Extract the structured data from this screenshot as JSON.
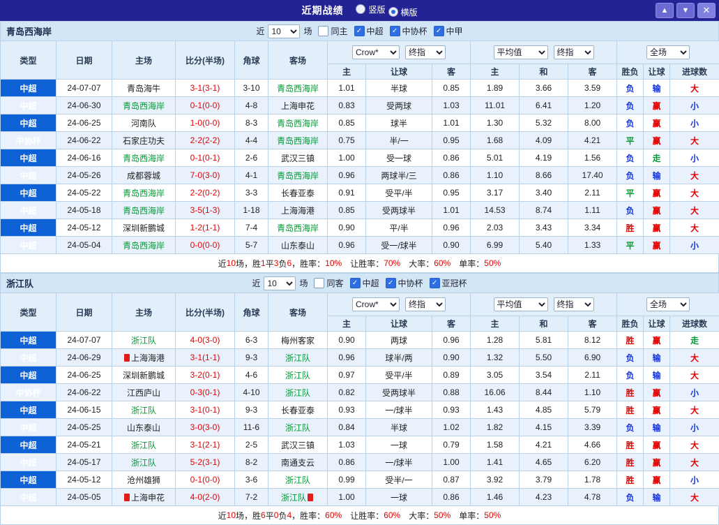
{
  "topbar": {
    "title": "近期战绩",
    "radios": [
      {
        "label": "竖版",
        "selected": false
      },
      {
        "label": "横版",
        "selected": true
      }
    ],
    "up": "▲",
    "down": "▼",
    "close": "✕"
  },
  "colors": {
    "topbar_bg": "#232394",
    "type_cell_blue": "#0f62d6",
    "win_red": "#e60000",
    "loss_blue": "#1535d8",
    "draw_green": "#009933",
    "team_green": "#009933",
    "alt_row": "#e9f2fc",
    "header_bg": "#e2eef9",
    "section_bar_bg": "#d2e6f6"
  },
  "columns": {
    "main": [
      "类型",
      "日期",
      "主场",
      "比分(半场)",
      "角球",
      "客场"
    ],
    "sub": [
      "主",
      "让球",
      "客",
      "主",
      "和",
      "客",
      "胜负",
      "让球",
      "进球数"
    ]
  },
  "sections": [
    {
      "team": "青岛西海岸",
      "controls": {
        "near": "近",
        "count": "10",
        "games": "场",
        "same": {
          "label": "同主",
          "checked": false
        },
        "leagues": [
          {
            "label": "中超",
            "checked": true
          },
          {
            "label": "中协杯",
            "checked": true
          },
          {
            "label": "中甲",
            "checked": true
          }
        ]
      },
      "selects": {
        "book": "Crow*",
        "book2": "终指",
        "avg": "平均值",
        "avg2": "终指",
        "scope": "全场"
      },
      "rows": [
        {
          "type": "中超",
          "date": "24-07-07",
          "home": {
            "t": "青岛海牛",
            "g": false
          },
          "score": "3-1(3-1)",
          "corner": "3-10",
          "away": {
            "t": "青岛西海岸",
            "g": true
          },
          "odds": [
            "1.01",
            "半球",
            "0.85"
          ],
          "avg": [
            "1.89",
            "3.66",
            "3.59"
          ],
          "res": [
            [
              "负",
              "blue"
            ],
            [
              "输",
              "blue"
            ],
            [
              "大",
              "red"
            ]
          ]
        },
        {
          "type": "中超",
          "date": "24-06-30",
          "home": {
            "t": "青岛西海岸",
            "g": true
          },
          "score": "0-1(0-0)",
          "corner": "4-8",
          "away": {
            "t": "上海申花",
            "g": false
          },
          "odds": [
            "0.83",
            "受两球",
            "1.03"
          ],
          "avg": [
            "11.01",
            "6.41",
            "1.20"
          ],
          "res": [
            [
              "负",
              "blue"
            ],
            [
              "赢",
              "red"
            ],
            [
              "小",
              "blue"
            ]
          ]
        },
        {
          "type": "中超",
          "date": "24-06-25",
          "home": {
            "t": "河南队",
            "g": false
          },
          "score": "1-0(0-0)",
          "corner": "8-3",
          "away": {
            "t": "青岛西海岸",
            "g": true
          },
          "odds": [
            "0.85",
            "球半",
            "1.01"
          ],
          "avg": [
            "1.30",
            "5.32",
            "8.00"
          ],
          "res": [
            [
              "负",
              "blue"
            ],
            [
              "赢",
              "red"
            ],
            [
              "小",
              "blue"
            ]
          ]
        },
        {
          "type": "中协杯",
          "date": "24-06-22",
          "home": {
            "t": "石家庄功夫",
            "g": false
          },
          "score": "2-2(2-2)",
          "corner": "4-4",
          "away": {
            "t": "青岛西海岸",
            "g": true
          },
          "odds": [
            "0.75",
            "半/一",
            "0.95"
          ],
          "avg": [
            "1.68",
            "4.09",
            "4.21"
          ],
          "res": [
            [
              "平",
              "green"
            ],
            [
              "赢",
              "red"
            ],
            [
              "大",
              "red"
            ]
          ]
        },
        {
          "type": "中超",
          "date": "24-06-16",
          "home": {
            "t": "青岛西海岸",
            "g": true
          },
          "score": "0-1(0-1)",
          "corner": "2-6",
          "away": {
            "t": "武汉三镇",
            "g": false
          },
          "odds": [
            "1.00",
            "受一球",
            "0.86"
          ],
          "avg": [
            "5.01",
            "4.19",
            "1.56"
          ],
          "res": [
            [
              "负",
              "blue"
            ],
            [
              "走",
              "green"
            ],
            [
              "小",
              "blue"
            ]
          ]
        },
        {
          "type": "中超",
          "date": "24-05-26",
          "home": {
            "t": "成都蓉城",
            "g": false
          },
          "score": "7-0(3-0)",
          "corner": "4-1",
          "away": {
            "t": "青岛西海岸",
            "g": true
          },
          "odds": [
            "0.96",
            "两球半/三",
            "0.86"
          ],
          "avg": [
            "1.10",
            "8.66",
            "17.40"
          ],
          "res": [
            [
              "负",
              "blue"
            ],
            [
              "输",
              "blue"
            ],
            [
              "大",
              "red"
            ]
          ]
        },
        {
          "type": "中超",
          "date": "24-05-22",
          "home": {
            "t": "青岛西海岸",
            "g": true
          },
          "score": "2-2(0-2)",
          "corner": "3-3",
          "away": {
            "t": "长春亚泰",
            "g": false
          },
          "odds": [
            "0.91",
            "受平/半",
            "0.95"
          ],
          "avg": [
            "3.17",
            "3.40",
            "2.11"
          ],
          "res": [
            [
              "平",
              "green"
            ],
            [
              "赢",
              "red"
            ],
            [
              "大",
              "red"
            ]
          ]
        },
        {
          "type": "中超",
          "date": "24-05-18",
          "home": {
            "t": "青岛西海岸",
            "g": true
          },
          "score": "3-5(1-3)",
          "corner": "1-18",
          "away": {
            "t": "上海海港",
            "g": false
          },
          "odds": [
            "0.85",
            "受两球半",
            "1.01"
          ],
          "avg": [
            "14.53",
            "8.74",
            "1.11"
          ],
          "res": [
            [
              "负",
              "blue"
            ],
            [
              "赢",
              "red"
            ],
            [
              "大",
              "red"
            ]
          ]
        },
        {
          "type": "中超",
          "date": "24-05-12",
          "home": {
            "t": "深圳新鹏城",
            "g": false
          },
          "score": "1-2(1-1)",
          "corner": "7-4",
          "away": {
            "t": "青岛西海岸",
            "g": true
          },
          "odds": [
            "0.90",
            "平/半",
            "0.96"
          ],
          "avg": [
            "2.03",
            "3.43",
            "3.34"
          ],
          "res": [
            [
              "胜",
              "red"
            ],
            [
              "赢",
              "red"
            ],
            [
              "大",
              "red"
            ]
          ]
        },
        {
          "type": "中超",
          "date": "24-05-04",
          "home": {
            "t": "青岛西海岸",
            "g": true
          },
          "score": "0-0(0-0)",
          "corner": "5-7",
          "away": {
            "t": "山东泰山",
            "g": false
          },
          "odds": [
            "0.96",
            "受一/球半",
            "0.90"
          ],
          "avg": [
            "6.99",
            "5.40",
            "1.33"
          ],
          "res": [
            [
              "平",
              "green"
            ],
            [
              "赢",
              "red"
            ],
            [
              "小",
              "blue"
            ]
          ]
        }
      ],
      "footer": [
        [
          "近",
          "black"
        ],
        [
          "10",
          "red"
        ],
        [
          "场，胜",
          "black"
        ],
        [
          "1",
          "red"
        ],
        [
          "平",
          "black"
        ],
        [
          "3",
          "red"
        ],
        [
          "负",
          "black"
        ],
        [
          "6",
          "red"
        ],
        [
          "，胜率：",
          "black"
        ],
        [
          "10%",
          "red"
        ],
        [
          "　让胜率：",
          "black"
        ],
        [
          "70%",
          "red"
        ],
        [
          "　大率：",
          "black"
        ],
        [
          "60%",
          "red"
        ],
        [
          "　单率：",
          "black"
        ],
        [
          "50%",
          "red"
        ]
      ]
    },
    {
      "team": "浙江队",
      "controls": {
        "near": "近",
        "count": "10",
        "games": "场",
        "same": {
          "label": "同客",
          "checked": false
        },
        "leagues": [
          {
            "label": "中超",
            "checked": true
          },
          {
            "label": "中协杯",
            "checked": true
          },
          {
            "label": "亚冠杯",
            "checked": true
          }
        ]
      },
      "selects": {
        "book": "Crow*",
        "book2": "终指",
        "avg": "平均值",
        "avg2": "终指",
        "scope": "全场"
      },
      "rows": [
        {
          "type": "中超",
          "date": "24-07-07",
          "home": {
            "t": "浙江队",
            "g": true
          },
          "score": "4-0(3-0)",
          "corner": "6-3",
          "away": {
            "t": "梅州客家",
            "g": false
          },
          "odds": [
            "0.90",
            "两球",
            "0.96"
          ],
          "avg": [
            "1.28",
            "5.81",
            "8.12"
          ],
          "res": [
            [
              "胜",
              "red"
            ],
            [
              "赢",
              "red"
            ],
            [
              "走",
              "green"
            ]
          ]
        },
        {
          "type": "中超",
          "date": "24-06-29",
          "home": {
            "t": "上海海港",
            "g": false,
            "icon": "before"
          },
          "score": "3-1(1-1)",
          "corner": "9-3",
          "away": {
            "t": "浙江队",
            "g": true
          },
          "odds": [
            "0.96",
            "球半/两",
            "0.90"
          ],
          "avg": [
            "1.32",
            "5.50",
            "6.90"
          ],
          "res": [
            [
              "负",
              "blue"
            ],
            [
              "输",
              "blue"
            ],
            [
              "大",
              "red"
            ]
          ]
        },
        {
          "type": "中超",
          "date": "24-06-25",
          "home": {
            "t": "深圳新鹏城",
            "g": false
          },
          "score": "3-2(0-1)",
          "corner": "4-6",
          "away": {
            "t": "浙江队",
            "g": true
          },
          "odds": [
            "0.97",
            "受平/半",
            "0.89"
          ],
          "avg": [
            "3.05",
            "3.54",
            "2.11"
          ],
          "res": [
            [
              "负",
              "blue"
            ],
            [
              "输",
              "blue"
            ],
            [
              "大",
              "red"
            ]
          ]
        },
        {
          "type": "中协杯",
          "date": "24-06-22",
          "home": {
            "t": "江西庐山",
            "g": false
          },
          "score": "0-3(0-1)",
          "corner": "4-10",
          "away": {
            "t": "浙江队",
            "g": true
          },
          "odds": [
            "0.82",
            "受两球半",
            "0.88"
          ],
          "avg": [
            "16.06",
            "8.44",
            "1.10"
          ],
          "res": [
            [
              "胜",
              "red"
            ],
            [
              "赢",
              "red"
            ],
            [
              "小",
              "blue"
            ]
          ]
        },
        {
          "type": "中超",
          "date": "24-06-15",
          "home": {
            "t": "浙江队",
            "g": true
          },
          "score": "3-1(0-1)",
          "corner": "9-3",
          "away": {
            "t": "长春亚泰",
            "g": false
          },
          "odds": [
            "0.93",
            "一/球半",
            "0.93"
          ],
          "avg": [
            "1.43",
            "4.85",
            "5.79"
          ],
          "res": [
            [
              "胜",
              "red"
            ],
            [
              "赢",
              "red"
            ],
            [
              "大",
              "red"
            ]
          ]
        },
        {
          "type": "中超",
          "date": "24-05-25",
          "home": {
            "t": "山东泰山",
            "g": false
          },
          "score": "3-0(3-0)",
          "corner": "11-6",
          "away": {
            "t": "浙江队",
            "g": true
          },
          "odds": [
            "0.84",
            "半球",
            "1.02"
          ],
          "avg": [
            "1.82",
            "4.15",
            "3.39"
          ],
          "res": [
            [
              "负",
              "blue"
            ],
            [
              "输",
              "blue"
            ],
            [
              "小",
              "blue"
            ]
          ]
        },
        {
          "type": "中超",
          "date": "24-05-21",
          "home": {
            "t": "浙江队",
            "g": true
          },
          "score": "3-1(2-1)",
          "corner": "2-5",
          "away": {
            "t": "武汉三镇",
            "g": false
          },
          "odds": [
            "1.03",
            "一球",
            "0.79"
          ],
          "avg": [
            "1.58",
            "4.21",
            "4.66"
          ],
          "res": [
            [
              "胜",
              "red"
            ],
            [
              "赢",
              "red"
            ],
            [
              "大",
              "red"
            ]
          ]
        },
        {
          "type": "中超",
          "date": "24-05-17",
          "home": {
            "t": "浙江队",
            "g": true
          },
          "score": "5-2(3-1)",
          "corner": "8-2",
          "away": {
            "t": "南通支云",
            "g": false
          },
          "odds": [
            "0.86",
            "一/球半",
            "1.00"
          ],
          "avg": [
            "1.41",
            "4.65",
            "6.20"
          ],
          "res": [
            [
              "胜",
              "red"
            ],
            [
              "赢",
              "red"
            ],
            [
              "大",
              "red"
            ]
          ]
        },
        {
          "type": "中超",
          "date": "24-05-12",
          "home": {
            "t": "沧州雄狮",
            "g": false
          },
          "score": "0-1(0-0)",
          "corner": "3-6",
          "away": {
            "t": "浙江队",
            "g": true
          },
          "odds": [
            "0.99",
            "受半/一",
            "0.87"
          ],
          "avg": [
            "3.92",
            "3.79",
            "1.78"
          ],
          "res": [
            [
              "胜",
              "red"
            ],
            [
              "赢",
              "red"
            ],
            [
              "小",
              "blue"
            ]
          ]
        },
        {
          "type": "中超",
          "date": "24-05-05",
          "home": {
            "t": "上海申花",
            "g": false,
            "icon": "before"
          },
          "score": "4-0(2-0)",
          "corner": "7-2",
          "away": {
            "t": "浙江队",
            "g": true,
            "icon": "after"
          },
          "odds": [
            "1.00",
            "一球",
            "0.86"
          ],
          "avg": [
            "1.46",
            "4.23",
            "4.78"
          ],
          "res": [
            [
              "负",
              "blue"
            ],
            [
              "输",
              "blue"
            ],
            [
              "大",
              "red"
            ]
          ]
        }
      ],
      "footer": [
        [
          "近",
          "black"
        ],
        [
          "10",
          "red"
        ],
        [
          "场，胜",
          "black"
        ],
        [
          "6",
          "red"
        ],
        [
          "平",
          "black"
        ],
        [
          "0",
          "red"
        ],
        [
          "负",
          "black"
        ],
        [
          "4",
          "red"
        ],
        [
          "，胜率：",
          "black"
        ],
        [
          "60%",
          "red"
        ],
        [
          "　让胜率：",
          "black"
        ],
        [
          "60%",
          "red"
        ],
        [
          "　大率：",
          "black"
        ],
        [
          "50%",
          "red"
        ],
        [
          "　单率：",
          "black"
        ],
        [
          "50%",
          "red"
        ]
      ]
    }
  ]
}
